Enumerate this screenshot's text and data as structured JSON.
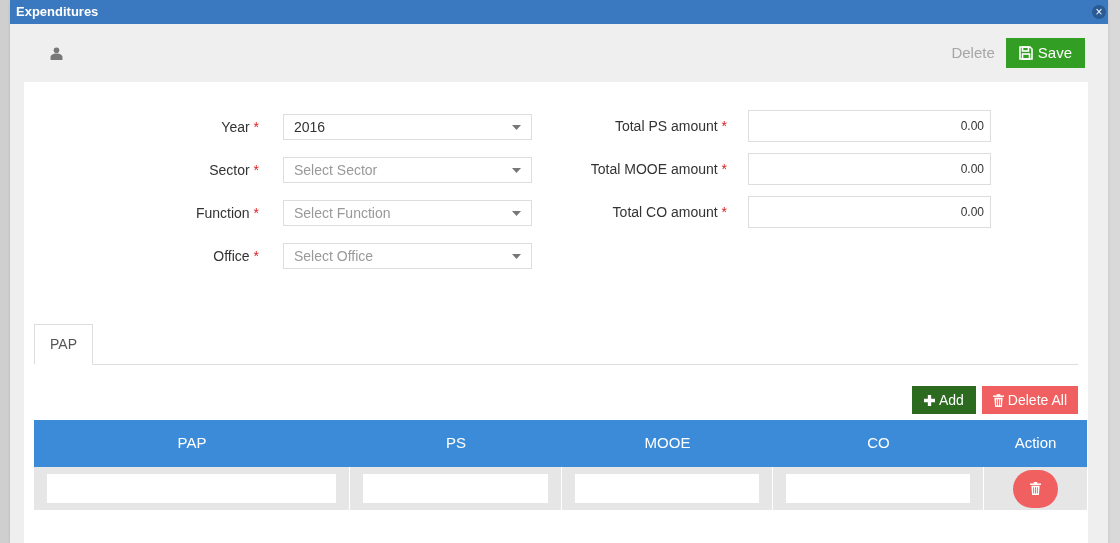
{
  "window": {
    "title": "Expenditures",
    "close": "×"
  },
  "toolbar": {
    "delete": {
      "label": "Delete",
      "disabled": true
    },
    "save": {
      "label": "Save"
    }
  },
  "left_fields": [
    {
      "label": "Year",
      "required_mark": "*",
      "value": "2016"
    },
    {
      "label": "Sector",
      "required_mark": "*",
      "placeholder": "Select Sector"
    },
    {
      "label": "Function",
      "required_mark": "*",
      "placeholder": "Select Function"
    },
    {
      "label": "Office",
      "required_mark": "*",
      "placeholder": "Select Office"
    }
  ],
  "right_fields": [
    {
      "label": "Total PS amount",
      "required_mark": "*",
      "value": "0.00"
    },
    {
      "label": "Total MOOE amount",
      "required_mark": "*",
      "value": "0.00"
    },
    {
      "label": "Total CO amount",
      "required_mark": "*",
      "value": "0.00"
    }
  ],
  "tabs": [
    {
      "label": "PAP",
      "selected": true
    }
  ],
  "table_actions": {
    "add": "Add",
    "delete_all": "Delete All"
  },
  "table": {
    "columns": [
      "PAP",
      "PS",
      "MOOE",
      "CO",
      "Action"
    ],
    "rows": [
      {
        "cells": [
          "",
          "",
          "",
          ""
        ]
      }
    ]
  }
}
